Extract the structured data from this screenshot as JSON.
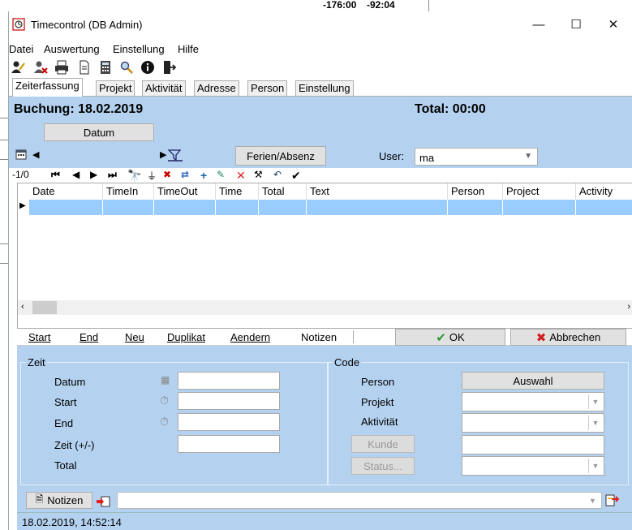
{
  "background": {
    "values": [
      "-176:00",
      "-92:04"
    ]
  },
  "window": {
    "title": "Timecontrol (DB Admin)",
    "controls": {
      "minimize": "—",
      "maximize": "☐",
      "close": "✕"
    }
  },
  "menu": [
    "Datei",
    "Auswertung",
    "Einstellung",
    "Hilfe"
  ],
  "toolbar_icons": [
    "user-edit-icon",
    "user-delete-icon",
    "printer-icon",
    "document-icon",
    "calculator-icon",
    "search-icon",
    "info-icon",
    "exit-door-icon"
  ],
  "tabs": [
    "Zeiterfassung",
    "Projekt",
    "Aktivität",
    "Adresse",
    "Person",
    "Einstellung"
  ],
  "active_tab": "Zeiterfassung",
  "header": {
    "booking": "Buchung: 18.02.2019",
    "total": "Total: 00:00",
    "datum_button": "Datum",
    "ferien_button": "Ferien/Absenz",
    "user_label": "User:",
    "user_value": "ma"
  },
  "nav": {
    "record_counter": "-1/0"
  },
  "grid": {
    "columns": [
      "Date",
      "TimeIn",
      "TimeOut",
      "Time",
      "Total",
      "Text",
      "Person",
      "Project",
      "Activity"
    ]
  },
  "actions": {
    "start": "Start",
    "end": "End",
    "neu": "Neu",
    "duplikat": "Duplikat",
    "aendern": "Aendern",
    "notizen": "Notizen",
    "ok": "OK",
    "abbrechen": "Abbrechen"
  },
  "zeit_group": {
    "title": "Zeit",
    "labels": {
      "datum": "Datum",
      "start": "Start",
      "end": "End",
      "zeit": "Zeit (+/-)",
      "total": "Total"
    }
  },
  "code_group": {
    "title": "Code",
    "labels": {
      "person": "Person",
      "projekt": "Projekt",
      "aktivitaet": "Aktivität"
    },
    "auswahl_button": "Auswahl",
    "kunde_button": "Kunde",
    "status_button": "Status..."
  },
  "notes": {
    "button": "Notizen"
  },
  "status_bar": "18.02.2019, 14:52:14",
  "colors": {
    "panel": "#b4d2f0",
    "selected_row": "#99ccff",
    "ok_check": "#2a9d2a",
    "cancel_x": "#d02020"
  }
}
